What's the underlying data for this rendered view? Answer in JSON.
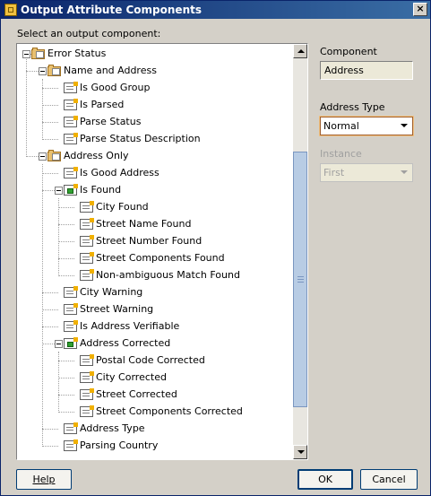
{
  "dialog": {
    "title": "Output Attribute Components",
    "close_label": "×"
  },
  "prompt": "Select an output component:",
  "tree": [
    {
      "label": "Error Status",
      "type": "folder",
      "depth": 0,
      "expander": true
    },
    {
      "label": "Name and Address",
      "type": "folder",
      "depth": 1,
      "expander": true
    },
    {
      "label": "Is Good Group",
      "type": "attr",
      "depth": 2
    },
    {
      "label": "Is Parsed",
      "type": "attr",
      "depth": 2
    },
    {
      "label": "Parse Status",
      "type": "attr",
      "depth": 2
    },
    {
      "label": "Parse Status Description",
      "type": "attr",
      "depth": 2
    },
    {
      "label": "Address Only",
      "type": "folder",
      "depth": 1,
      "expander": true
    },
    {
      "label": "Is Good Address",
      "type": "attr",
      "depth": 2
    },
    {
      "label": "Is Found",
      "type": "group",
      "depth": 2,
      "expander": true
    },
    {
      "label": "City Found",
      "type": "attr",
      "depth": 3
    },
    {
      "label": "Street Name Found",
      "type": "attr",
      "depth": 3
    },
    {
      "label": "Street Number Found",
      "type": "attr",
      "depth": 3
    },
    {
      "label": "Street Components Found",
      "type": "attr",
      "depth": 3
    },
    {
      "label": "Non-ambiguous Match Found",
      "type": "attr",
      "depth": 3
    },
    {
      "label": "City Warning",
      "type": "attr",
      "depth": 2
    },
    {
      "label": "Street Warning",
      "type": "attr",
      "depth": 2
    },
    {
      "label": "Is Address Verifiable",
      "type": "attr",
      "depth": 2
    },
    {
      "label": "Address Corrected",
      "type": "group",
      "depth": 2,
      "expander": true
    },
    {
      "label": "Postal Code Corrected",
      "type": "attr",
      "depth": 3
    },
    {
      "label": "City Corrected",
      "type": "attr",
      "depth": 3
    },
    {
      "label": "Street Corrected",
      "type": "attr",
      "depth": 3
    },
    {
      "label": "Street Components Corrected",
      "type": "attr",
      "depth": 3
    },
    {
      "label": "Address Type",
      "type": "attr",
      "depth": 2
    },
    {
      "label": "Parsing Country",
      "type": "attr",
      "depth": 2
    }
  ],
  "side": {
    "component_label": "Component",
    "component_value": "Address",
    "address_type_label": "Address Type",
    "address_type_value": "Normal",
    "instance_label": "Instance",
    "instance_value": "First"
  },
  "buttons": {
    "help": "Help",
    "ok": "OK",
    "cancel": "Cancel"
  },
  "colors": {
    "titlebar_start": "#0a246a",
    "titlebar_end": "#3a6ea5",
    "dialog_bg": "#d4d0c8",
    "scroll_thumb": "#b8cce4"
  }
}
